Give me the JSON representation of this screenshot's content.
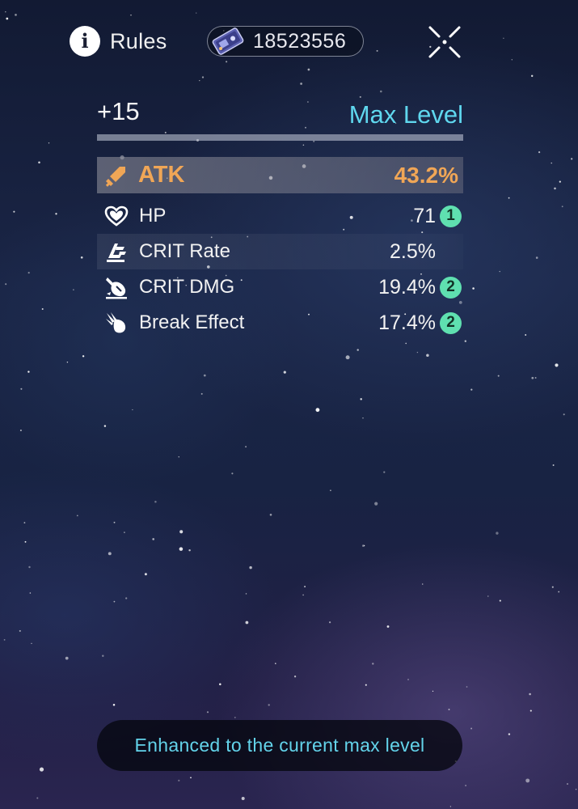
{
  "header": {
    "rules_label": "Rules",
    "currency_amount": "18523556"
  },
  "relic": {
    "level": "+15",
    "level_status": "Max Level",
    "level_progress": 1.0,
    "main_stat": {
      "name": "ATK",
      "value": "43.2%",
      "icon": "atk-sword-icon"
    },
    "sub_stats": [
      {
        "name": "HP",
        "value": "71",
        "rolls": "1",
        "icon": "hp-heart-icon"
      },
      {
        "name": "CRIT Rate",
        "value": "2.5%",
        "rolls": "",
        "icon": "crit-rate-icon"
      },
      {
        "name": "CRIT DMG",
        "value": "19.4%",
        "rolls": "2",
        "icon": "crit-dmg-icon"
      },
      {
        "name": "Break Effect",
        "value": "17.4%",
        "rolls": "2",
        "icon": "break-effect-icon"
      }
    ]
  },
  "toast": {
    "message": "Enhanced to the current max level"
  },
  "colors": {
    "accent_cyan": "#5fd7ee",
    "main_stat_orange": "#f0a656",
    "roll_badge_green": "#5fe0b0"
  }
}
